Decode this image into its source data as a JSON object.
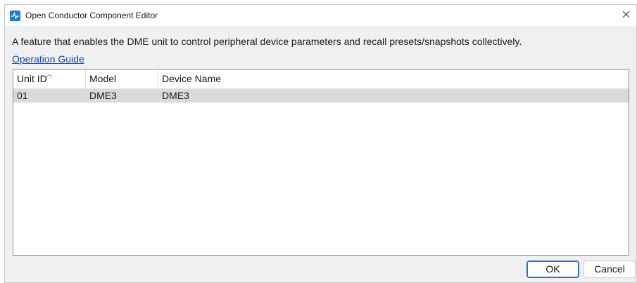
{
  "window": {
    "title": "Open Conductor Component Editor",
    "close_glyph": "✕"
  },
  "description": "A feature that enables the DME unit to control peripheral device parameters and recall presets/snapshots collectively.",
  "operation_guide_link": "Operation Guide",
  "table": {
    "columns": [
      "Unit ID",
      "Model",
      "Device Name"
    ],
    "sort_column": "Unit ID",
    "rows": [
      {
        "unit_id": "01",
        "model": "DME3",
        "device_name": "DME3",
        "selected": true
      }
    ]
  },
  "buttons": {
    "ok": "OK",
    "cancel": "Cancel"
  },
  "colors": {
    "accent": "#1f7ad1",
    "link": "#0645d8",
    "selected_row": "#dadada"
  },
  "icons": {
    "app": "conductor-app-icon",
    "close": "close-icon",
    "sort": "sort-ascending-icon"
  }
}
